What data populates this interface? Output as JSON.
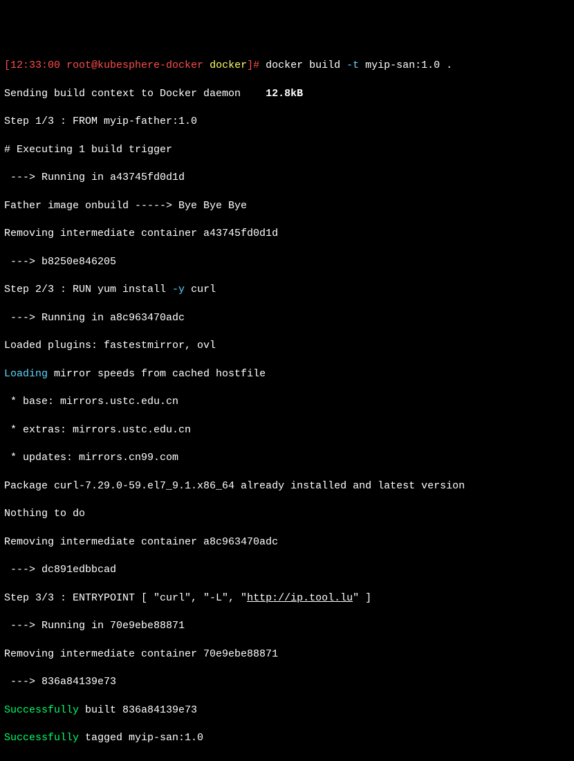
{
  "prompt": {
    "lbracket": "[",
    "time": "12:33:00",
    "userhost": " root@kubesphere-docker ",
    "cwd": "docker",
    "rbracket_hash": "]# ",
    "cmd_prefix": "docker build ",
    "flag_t": "-t",
    "cmd_rest": " myip-san:1.0 ."
  },
  "lines": {
    "l1a": "Sending build context to Docker daemon    ",
    "l1b": "12.8kB",
    "l2": "Step 1/3 : FROM myip-father:1.0",
    "l3": "# Executing 1 build trigger",
    "l4": " ---> Running in a43745fd0d1d",
    "l5": "Father image onbuild -----> Bye Bye Bye",
    "l6": "Removing intermediate container a43745fd0d1d",
    "l7": " ---> b8250e846205",
    "l8a": "Step 2/3 : RUN yum install ",
    "l8b": "-y",
    "l8c": " curl",
    "l9": " ---> Running in a8c963470adc",
    "l10": "Loaded plugins: fastestmirror, ovl",
    "l11a": "Loading",
    "l11b": " mirror speeds from cached hostfile",
    "l12": " * base: mirrors.ustc.edu.cn",
    "l13": " * extras: mirrors.ustc.edu.cn",
    "l14": " * updates: mirrors.cn99.com",
    "l15": "Package curl-7.29.0-59.el7_9.1.x86_64 already installed and latest version",
    "l16": "Nothing to do",
    "l17": "Removing intermediate container a8c963470adc",
    "l18": " ---> dc891edbbcad",
    "l19a": "Step 3/3 : ENTRYPOINT [ \"curl\", \"-L\", \"",
    "l19b": "http://ip.tool.lu",
    "l19c": "\" ]",
    "l20": " ---> Running in 70e9ebe88871",
    "l21": "Removing intermediate container 70e9ebe88871",
    "l22": " ---> 836a84139e73",
    "l23a": "Successfully",
    "l23b": " built 836a84139e73",
    "l24a": "Successfully",
    "l24b": " tagged myip-san:1.0"
  }
}
